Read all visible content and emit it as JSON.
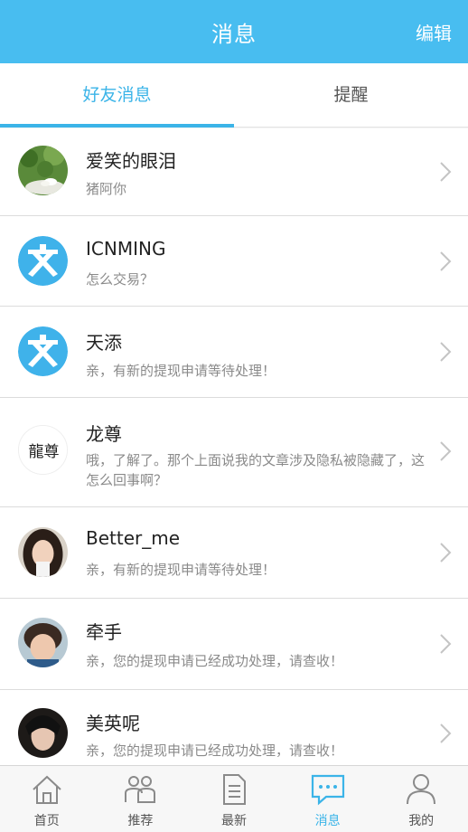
{
  "header": {
    "title": "消息",
    "edit_label": "编辑",
    "bg_color": "#48bdf0"
  },
  "tabs": [
    {
      "label": "好友消息",
      "active": true
    },
    {
      "label": "提醒",
      "active": false
    }
  ],
  "conversations": [
    {
      "name": "爱笑的眼泪",
      "message": "猪阿你",
      "avatar": "flower-photo"
    },
    {
      "name": "ICNMING",
      "message": "怎么交易？",
      "avatar": "wen-logo"
    },
    {
      "name": "天添",
      "message": "亲，有新的提现申请等待处理！",
      "avatar": "wen-logo"
    },
    {
      "name": "龙尊",
      "message": "哦，了解了。那个上面说我的文章涉及隐私被隐藏了，这怎么回事啊？",
      "avatar": "calligraphy",
      "calligraphy_text": "龍尊"
    },
    {
      "name": "Better_me",
      "message": "亲，有新的提现申请等待处理！",
      "avatar": "girl-photo"
    },
    {
      "name": "牵手",
      "message": "亲，您的提现申请已经成功处理，请查收！",
      "avatar": "boy-photo"
    },
    {
      "name": "美英呢",
      "message": "亲，您的提现申请已经成功处理，请查收！",
      "avatar": "girl-photo-2"
    }
  ],
  "tabbar": [
    {
      "label": "首页",
      "icon": "home-icon",
      "active": false
    },
    {
      "label": "推荐",
      "icon": "people-icon",
      "active": false
    },
    {
      "label": "最新",
      "icon": "document-icon",
      "active": false
    },
    {
      "label": "消息",
      "icon": "chat-icon",
      "active": true
    },
    {
      "label": "我的",
      "icon": "user-icon",
      "active": false
    }
  ],
  "colors": {
    "accent": "#3bb4e8",
    "wen_logo": "#3fb2ea"
  }
}
